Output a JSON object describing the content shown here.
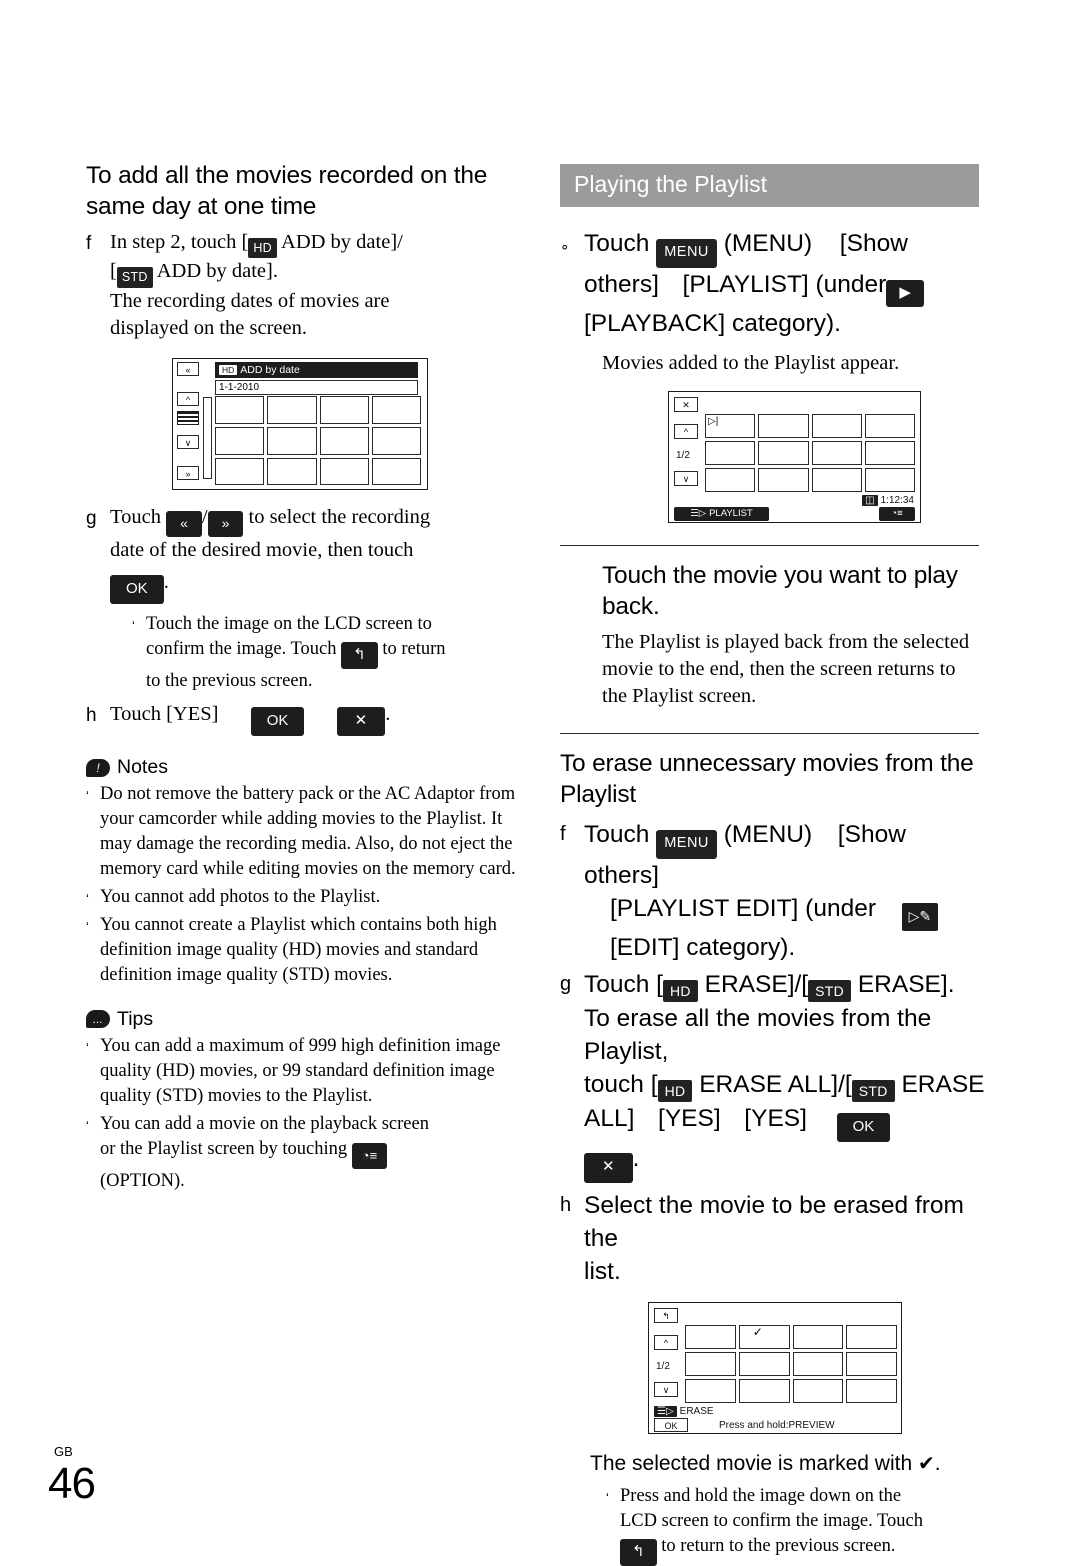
{
  "page": {
    "folio_prefix": "GB",
    "folio_number": "46"
  },
  "left": {
    "heading": "To add all the movies recorded on the same day at one time",
    "step_f_marker": "f",
    "step_f_line1_pre": "In step 2, touch [",
    "step_f_chip_hd": "HD",
    "step_f_line1_mid": " ADD by date]/",
    "step_f_line2_pre": "[",
    "step_f_chip_std": "STD",
    "step_f_line2_post": " ADD by date].",
    "step_f_line3": "The recording dates of movies are",
    "step_f_line4": "displayed on the screen.",
    "screen1": {
      "title": "ADD by date",
      "title_icon": "hd-icon",
      "date": "1-1-2010",
      "btn_up2": "«",
      "btn_up1": "^",
      "btn_down1": "∨",
      "btn_down2": "»"
    },
    "step_g_marker": "g",
    "step_g_pre": "Touch ",
    "step_g_chip_a": "«",
    "step_g_sep": "/",
    "step_g_chip_b": "»",
    "step_g_post": " to select the recording",
    "step_g_line2": "date of the desired movie, then touch",
    "step_g_ok": "OK",
    "step_g_period": ".",
    "sub_g_line1": "Touch the image on the LCD screen to",
    "sub_g_line2_pre": "confirm the image. Touch ",
    "sub_g_back_icon": "back-arrow-icon",
    "sub_g_line2_post": " to return",
    "sub_g_line3": "to the previous screen.",
    "step_h_marker": "h",
    "step_h_text": "Touch [YES]",
    "step_h_ok": "OK",
    "step_h_x": "✕",
    "step_h_period": ".",
    "notes_label": "Notes",
    "notes_bubble": "!",
    "notes": [
      "Do not remove the battery pack or the AC Adaptor from your camcorder while adding movies to the Playlist. It may damage the recording media. Also, do not eject the memory card while editing movies on the memory card.",
      "You cannot add photos to the Playlist.",
      "You cannot create a Playlist which contains both high definition image quality (HD) movies and standard definition image quality (STD) movies."
    ],
    "tips_label": "Tips",
    "tips_bubble": "...",
    "tips": [
      "You can add a maximum of 999 high definition image quality (HD) movies, or 99 standard definition image quality (STD) movies to the Playlist."
    ],
    "tip_last_line1": "You can add a movie on the playback screen",
    "tip_last_line2_pre": "or the Playlist screen by touching ",
    "tip_last_option_icon": "option-icon",
    "tip_last_line3": "(OPTION)."
  },
  "right": {
    "band_title": "Playing the Playlist",
    "step1_marker": "∘",
    "step1_pre": "Touch ",
    "step1_menu": "MENU",
    "step1_menu_paren": "(MENU)",
    "step1_show": "[Show",
    "step1_line2_a": "others]",
    "step1_line2_b": "[PLAYLIST] (under",
    "step1_line2_icon": "playback-icon",
    "step1_line3": "[PLAYBACK] category).",
    "step1_note": "Movies added to the Playlist appear.",
    "screen2": {
      "close": "✕",
      "up": "^",
      "page": "1/2",
      "down": "∨",
      "playlist_btn": "PLAYLIST",
      "playlist_icon": "playlist-icon",
      "duration": "1:12:34",
      "duration_icon": "tape-icon",
      "option_icon": "option-icon",
      "first_thumb_icon": "playlist-marker-icon"
    },
    "step2_heading": "Touch the movie you want to play back.",
    "step2_body": "The Playlist is played back from the selected movie to the end, then the screen returns to the Playlist screen.",
    "erase_heading": "To erase unnecessary movies from the Playlist",
    "erase_f_marker": "f",
    "erase_f_pre": "Touch ",
    "erase_f_menu": "MENU",
    "erase_f_menu_paren": "(MENU)",
    "erase_f_show": "[Show others]",
    "erase_f_line2_pre": "[PLAYLIST EDIT] (under",
    "erase_f_line2_icon": "edit-icon",
    "erase_f_line3": "[EDIT] category).",
    "erase_g_marker": "g",
    "erase_g_pre": "Touch [",
    "erase_g_chip_hd": "HD",
    "erase_g_mid": " ERASE]/[",
    "erase_g_chip_std": "STD",
    "erase_g_post": " ERASE].",
    "erase_g_line2": "To erase all the movies from the Playlist,",
    "erase_g_line3_pre": "touch [",
    "erase_g_line3_mid": " ERASE ALL]/[",
    "erase_g_line3_post": " ERASE",
    "erase_g_line4_a": "ALL]",
    "erase_g_line4_b": "[YES]",
    "erase_g_line4_c": "[YES]",
    "erase_g_ok": "OK",
    "erase_g_x": "✕",
    "erase_g_period": ".",
    "erase_h_marker": "h",
    "erase_h_line1": "Select the movie to be erased from the",
    "erase_h_line2": "list.",
    "screen3": {
      "back": "back-arrow-icon",
      "up": "^",
      "page": "1/2",
      "down": "∨",
      "erase_label": "ERASE",
      "erase_icon": "erase-icon",
      "ok": "OK",
      "hint": "Press and hold:PREVIEW",
      "check": "✓"
    },
    "screen3_caption_pre": "The selected movie is marked with ",
    "screen3_caption_check": "✔",
    "screen3_caption_post": ".",
    "screen3_sub_line1": "Press and hold the image down on the",
    "screen3_sub_line2": "LCD screen to confirm the image. Touch",
    "screen3_sub_icon": "back-arrow-icon",
    "screen3_sub_line3": " to return to the previous screen."
  }
}
